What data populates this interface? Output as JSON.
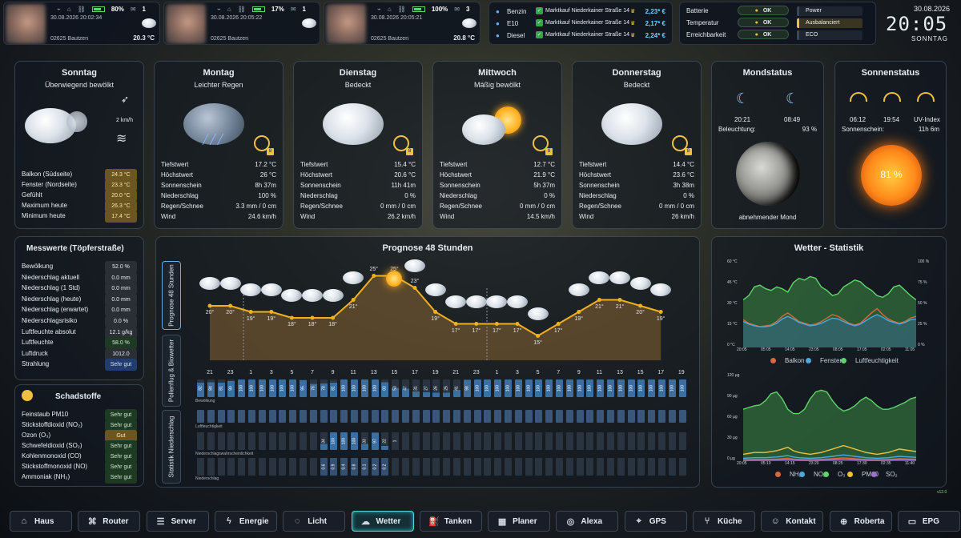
{
  "top": {
    "cams": [
      {
        "pct": "80%",
        "mail": "1",
        "time": "30.08.2026 20:02:34",
        "place": "02625 Bautzen",
        "temp": "20.3 °C"
      },
      {
        "pct": "17%",
        "mail": "1",
        "time": "30.08.2026 20:05:22",
        "place": "02625 Bautzen",
        "temp": ""
      },
      {
        "pct": "100%",
        "mail": "3",
        "time": "30.08.2026 20:05:21",
        "place": "02625 Bautzen",
        "temp": "20.8 °C"
      }
    ],
    "fuel": [
      {
        "type": "Benzin",
        "station": "Marktkauf Niederkainer Straße 14",
        "price": "2,23* €"
      },
      {
        "type": "E10",
        "station": "Marktkauf Niederkainer Straße 14",
        "price": "2,17* €"
      },
      {
        "type": "Diesel",
        "station": "Marktkauf Niederkainer Straße 14",
        "price": "2,24* €"
      }
    ],
    "status": [
      {
        "label": "Batterie",
        "value": "OK"
      },
      {
        "label": "Temperatur",
        "value": "OK"
      },
      {
        "label": "Erreichbarkeit",
        "value": "OK"
      }
    ],
    "modes": [
      "Power",
      "Ausbalanciert",
      "ECO"
    ],
    "date": "30.08.2026",
    "time": "20:05",
    "weekday": "SONNTAG"
  },
  "today": {
    "title": "Sonntag",
    "desc": "Überwiegend bewölkt",
    "wind": "2 km/h",
    "rows": [
      {
        "k": "Balkon (Südseite)",
        "v": "24.3 °C"
      },
      {
        "k": "Fenster (Nordseite)",
        "v": "23.3 °C"
      },
      {
        "k": "Gefühlt",
        "v": "20.0 °C"
      },
      {
        "k": "Maximum heute",
        "v": "26.3 °C"
      },
      {
        "k": "Minimum heute",
        "v": "17.4 °C"
      }
    ]
  },
  "days": [
    {
      "title": "Montag",
      "desc": "Leichter Regen",
      "uv": "8",
      "rows": [
        [
          "Tiefstwert",
          "17.2 °C"
        ],
        [
          "Höchstwert",
          "26 °C"
        ],
        [
          "Sonnenschein",
          "8h 37m"
        ],
        [
          "Niederschlag",
          "100 %"
        ],
        [
          "Regen/Schnee",
          "3.3 mm / 0 cm"
        ],
        [
          "Wind",
          "24.6 km/h"
        ]
      ]
    },
    {
      "title": "Dienstag",
      "desc": "Bedeckt",
      "uv": "8",
      "rows": [
        [
          "Tiefstwert",
          "15.4 °C"
        ],
        [
          "Höchstwert",
          "20.6 °C"
        ],
        [
          "Sonnenschein",
          "11h 41m"
        ],
        [
          "Niederschlag",
          "0 %"
        ],
        [
          "Regen/Schnee",
          "0 mm / 0 cm"
        ],
        [
          "Wind",
          "26.2 km/h"
        ]
      ]
    },
    {
      "title": "Mittwoch",
      "desc": "Mäßig bewölkt",
      "uv": "8",
      "rows": [
        [
          "Tiefstwert",
          "12.7 °C"
        ],
        [
          "Höchstwert",
          "21.9 °C"
        ],
        [
          "Sonnenschein",
          "5h 37m"
        ],
        [
          "Niederschlag",
          "0 %"
        ],
        [
          "Regen/Schnee",
          "0 mm / 0 cm"
        ],
        [
          "Wind",
          "14.5 km/h"
        ]
      ]
    },
    {
      "title": "Donnerstag",
      "desc": "Bedeckt",
      "uv": "8",
      "rows": [
        [
          "Tiefstwert",
          "14.4 °C"
        ],
        [
          "Höchstwert",
          "23.6 °C"
        ],
        [
          "Sonnenschein",
          "3h 38m"
        ],
        [
          "Niederschlag",
          "0 %"
        ],
        [
          "Regen/Schnee",
          "0 mm / 0 cm"
        ],
        [
          "Wind",
          "26 km/h"
        ]
      ]
    }
  ],
  "moon": {
    "title": "Mondstatus",
    "rise": "20:21",
    "set": "08:49",
    "illum_label": "Beleuchtung:",
    "illum": "93 %",
    "phase": "abnehmender Mond"
  },
  "sun": {
    "title": "Sonnenstatus",
    "rise": "06:12",
    "set": "19:54",
    "uv_label": "UV-Index",
    "sun_label": "Sonnenschein:",
    "sun_val": "11h 6m",
    "pct": "81 %"
  },
  "mess": {
    "title": "Messwerte (Töpferstraße)",
    "rows": [
      {
        "k": "Bewölkung",
        "v": "52.0 %",
        "c": "dk"
      },
      {
        "k": "Niederschlag aktuell",
        "v": "0.0 mm",
        "c": "dk"
      },
      {
        "k": "Niederschlag (1 Std)",
        "v": "0.0 mm",
        "c": "dk"
      },
      {
        "k": "Niederschlag (heute)",
        "v": "0.0 mm",
        "c": "dk"
      },
      {
        "k": "Niederschlag (erwartet)",
        "v": "0.0 mm",
        "c": "dk"
      },
      {
        "k": "Niederschlagsrisiko",
        "v": "0.0 %",
        "c": "dk"
      },
      {
        "k": "Luftfeuchte absolut",
        "v": "12.1 g/kg",
        "c": "dk"
      },
      {
        "k": "Luftfeuchte",
        "v": "58.0 %",
        "c": "gr"
      },
      {
        "k": "Luftdruck",
        "v": "1012.0",
        "c": "dk"
      },
      {
        "k": "Strahlung",
        "v": "Sehr gut",
        "c": "bl"
      }
    ]
  },
  "schad": {
    "title": "Schadstoffe",
    "rows": [
      {
        "k": "Feinstaub PM10",
        "v": "Sehr gut",
        "c": "gr"
      },
      {
        "k": "Stickstoffdioxid (NO₂)",
        "v": "Sehr gut",
        "c": "gr"
      },
      {
        "k": "Ozon (O₃)",
        "v": "Gut",
        "c": "am"
      },
      {
        "k": "Schwefeldioxid (SO₂)",
        "v": "Sehr gut",
        "c": "gr"
      },
      {
        "k": "Kohlenmonoxid (CO)",
        "v": "Sehr gut",
        "c": "gr"
      },
      {
        "k": "Stickstoffmonoxid (NO)",
        "v": "Sehr gut",
        "c": "gr"
      },
      {
        "k": "Ammoniak (NH₃)",
        "v": "Sehr gut",
        "c": "gr"
      }
    ]
  },
  "forecast": {
    "title": "Prognose 48 Stunden",
    "tabs": [
      "Prognose 48 Stunden",
      "Pollenflug & Biowetter",
      "Statistik Niederschlag"
    ],
    "temps": [
      "20°",
      "20°",
      "19°",
      "19°",
      "18°",
      "18°",
      "18°",
      "21°",
      "25°",
      "25°",
      "23°",
      "19°",
      "17°",
      "17°",
      "17°",
      "17°",
      "15°",
      "17°",
      "19°",
      "21°",
      "21°",
      "20°",
      "19°"
    ],
    "hours": [
      "21",
      "23",
      "1",
      "3",
      "5",
      "7",
      "9",
      "11",
      "13",
      "15",
      "17",
      "19",
      "21",
      "23",
      "1",
      "3",
      "5",
      "7",
      "9",
      "11",
      "13",
      "15",
      "17",
      "19"
    ],
    "cloud": [
      "82",
      "84",
      "81",
      "90",
      "100",
      "100",
      "100",
      "100",
      "100",
      "100",
      "95",
      "76",
      "78",
      "81",
      "100",
      "100",
      "100",
      "100",
      "83",
      "53",
      "47",
      "31",
      "27",
      "26",
      "25",
      "41",
      "98",
      "100",
      "100",
      "100",
      "100",
      "100",
      "100",
      "100",
      "100",
      "100",
      "100",
      "100",
      "100",
      "100",
      "100",
      "100",
      "100",
      "100",
      "100",
      "100",
      "100",
      "100"
    ],
    "row_labels": [
      "Bewölkung",
      "Luftfeuchtigkeit",
      "Niederschlagswahrscheinlichkeit",
      "Niederschlag"
    ],
    "precip_prob": [
      "34",
      "100",
      "100",
      "100",
      "33",
      "97",
      "22",
      "1"
    ],
    "precip": [
      "0.6",
      "0.9",
      "0.4",
      "0.8",
      "0.1",
      "0.2",
      "0.2"
    ]
  },
  "stat": {
    "title": "Wetter - Statistik",
    "y1": [
      "60 °C",
      "45 °C",
      "30 °C",
      "15 °C",
      "0 °C"
    ],
    "y1r": [
      "100 %",
      "75 %",
      "50 %",
      "25 %",
      "0 %"
    ],
    "x1": [
      "20:05",
      "05:05",
      "14:05",
      "23:05",
      "08:05",
      "17:05",
      "02:05",
      "11:05"
    ],
    "legend1": [
      {
        "n": "Balkon",
        "c": "#d9683c"
      },
      {
        "n": "Fenster",
        "c": "#4da8e0"
      },
      {
        "n": "Luftfeuchtigkeit",
        "c": "#5fd46a"
      }
    ],
    "y2": [
      "120 µg",
      "90 µg",
      "60 µg",
      "30 µg",
      "0 µg"
    ],
    "x2": [
      "20:05",
      "05:10",
      "14:15",
      "23:20",
      "08:25",
      "17:30",
      "02:35",
      "11:40"
    ],
    "legend2": [
      {
        "n": "NH₃",
        "c": "#d9683c"
      },
      {
        "n": "NO₂",
        "c": "#4da8e0"
      },
      {
        "n": "O₃",
        "c": "#5fd46a"
      },
      {
        "n": "PM10",
        "c": "#f0c040"
      },
      {
        "n": "SO₂",
        "c": "#a070d0"
      }
    ]
  },
  "version": "v12.0",
  "nav": [
    {
      "l": "Haus",
      "i": "⌂"
    },
    {
      "l": "Router",
      "i": "⌘"
    },
    {
      "l": "Server",
      "i": "☰"
    },
    {
      "l": "Energie",
      "i": "ϟ"
    },
    {
      "l": "Licht",
      "i": "◌"
    },
    {
      "l": "Wetter",
      "i": "☁"
    },
    {
      "l": "Tanken",
      "i": "⛽"
    },
    {
      "l": "Planer",
      "i": "▦"
    },
    {
      "l": "Alexa",
      "i": "◎"
    },
    {
      "l": "GPS",
      "i": "⌖"
    },
    {
      "l": "Küche",
      "i": "⑂"
    },
    {
      "l": "Kontakt",
      "i": "☺"
    },
    {
      "l": "Roberta",
      "i": "⊕"
    },
    {
      "l": "EPG",
      "i": "▭"
    }
  ]
}
